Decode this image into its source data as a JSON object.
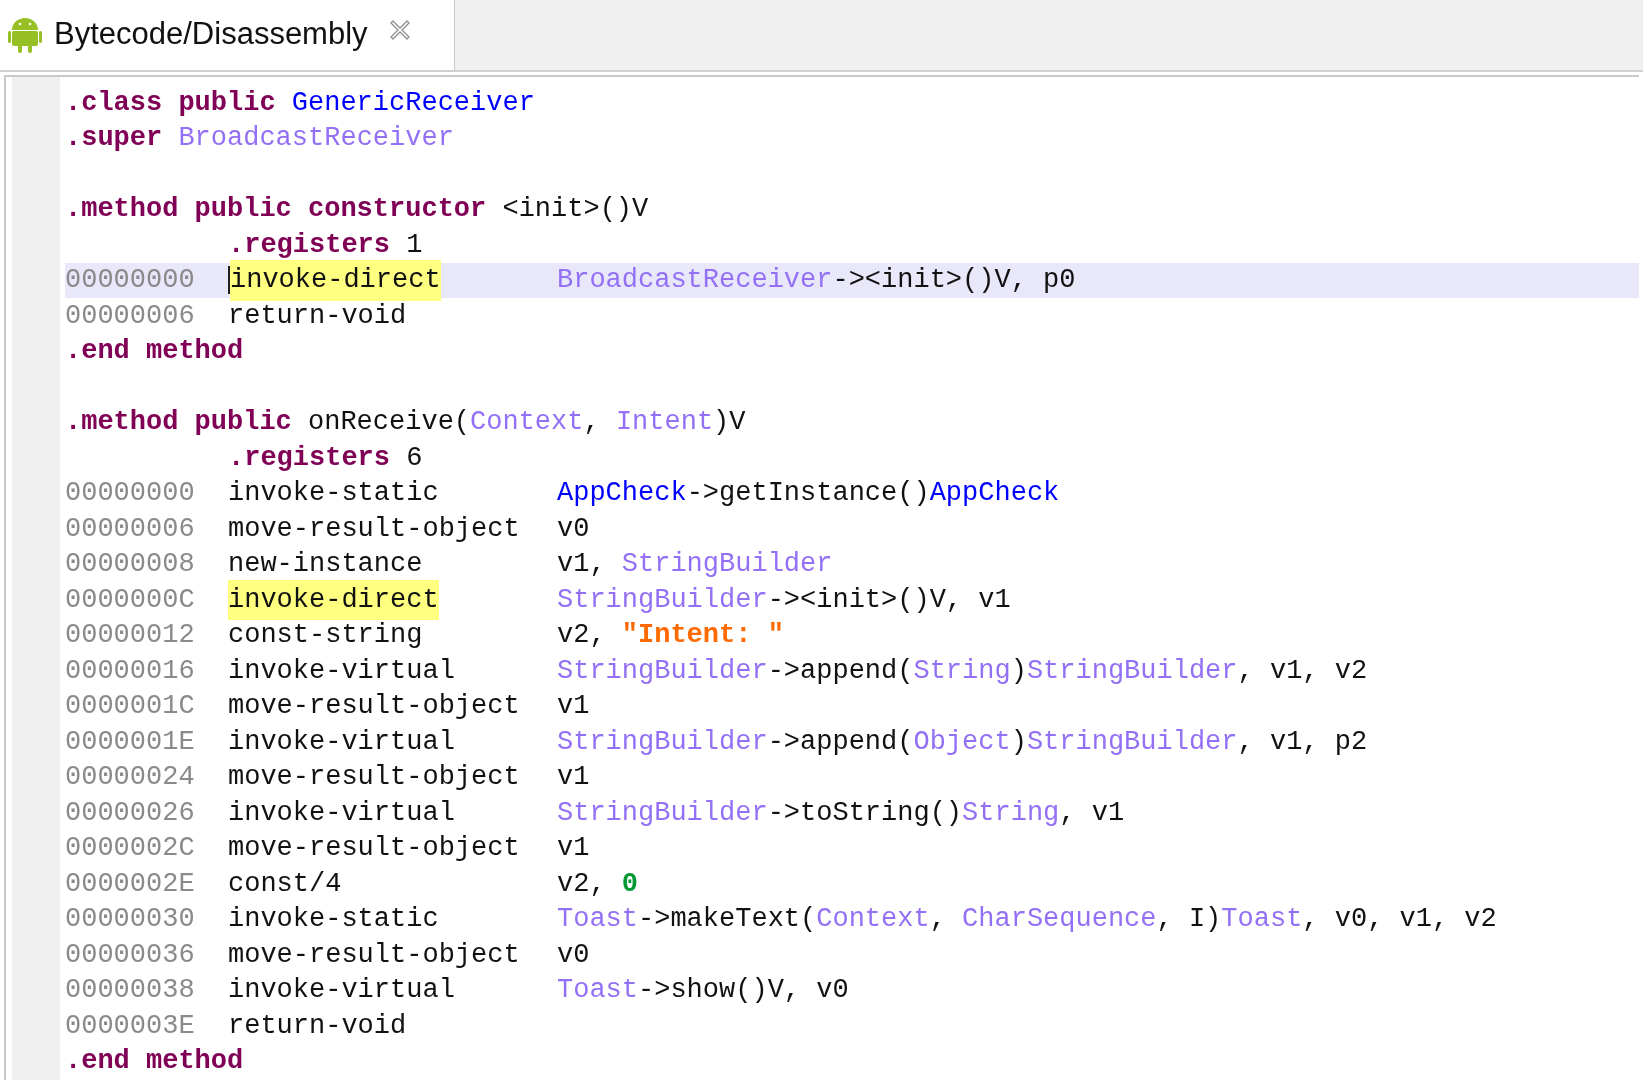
{
  "tab": {
    "title": "Bytecode/Disassembly",
    "selected": true
  },
  "lines": [
    {
      "kind": "directive",
      "tokens": [
        {
          "kind": "keyword",
          "text": ".class"
        },
        {
          "kind": "keyword",
          "text": "public"
        },
        {
          "kind": "class",
          "text": "GenericReceiver"
        }
      ]
    },
    {
      "kind": "directive",
      "tokens": [
        {
          "kind": "keyword",
          "text": ".super"
        },
        {
          "kind": "type",
          "text": "BroadcastReceiver"
        }
      ]
    },
    {
      "kind": "blank"
    },
    {
      "kind": "directive",
      "tokens": [
        {
          "kind": "keyword",
          "text": ".method"
        },
        {
          "kind": "keyword",
          "text": "public"
        },
        {
          "kind": "keyword",
          "text": "constructor"
        },
        {
          "kind": "plain",
          "text": "<init>()V"
        }
      ]
    },
    {
      "kind": "indented_directive",
      "tokens": [
        {
          "kind": "keyword",
          "text": ".registers"
        },
        {
          "kind": "plain",
          "text": "1"
        }
      ]
    },
    {
      "kind": "instruction",
      "address": "00000000",
      "opcode": "invoke-direct",
      "highlighted": true,
      "current": true,
      "operands": [
        {
          "kind": "type",
          "text": "BroadcastReceiver"
        },
        {
          "kind": "plain",
          "text": "-><init>()V, p0"
        }
      ]
    },
    {
      "kind": "instruction",
      "address": "00000006",
      "opcode": "return-void",
      "highlighted": false,
      "current": false
    },
    {
      "kind": "directive",
      "tokens": [
        {
          "kind": "keyword",
          "text": ".end"
        },
        {
          "kind": "keyword",
          "text": "method"
        }
      ]
    },
    {
      "kind": "blank"
    },
    {
      "kind": "directive",
      "tokens": [
        {
          "kind": "keyword",
          "text": ".method"
        },
        {
          "kind": "keyword",
          "text": "public"
        },
        {
          "kind": "plain",
          "text": "onReceive("
        },
        {
          "kind": "type",
          "text": "Context"
        },
        {
          "kind": "plain",
          "text": ", "
        },
        {
          "kind": "type",
          "text": "Intent"
        },
        {
          "kind": "plain",
          "text": ")V"
        }
      ]
    },
    {
      "kind": "indented_directive",
      "tokens": [
        {
          "kind": "keyword",
          "text": ".registers"
        },
        {
          "kind": "plain",
          "text": "6"
        }
      ]
    },
    {
      "kind": "instruction",
      "address": "00000000",
      "opcode": "invoke-static",
      "highlighted": false,
      "current": false,
      "operands": [
        {
          "kind": "class",
          "text": "AppCheck"
        },
        {
          "kind": "plain",
          "text": "->getInstance()"
        },
        {
          "kind": "class",
          "text": "AppCheck"
        }
      ]
    },
    {
      "kind": "instruction",
      "address": "00000006",
      "opcode": "move-result-object",
      "highlighted": false,
      "current": false,
      "operands": [
        {
          "kind": "plain",
          "text": "v0"
        }
      ]
    },
    {
      "kind": "instruction",
      "address": "00000008",
      "opcode": "new-instance",
      "highlighted": false,
      "current": false,
      "operands": [
        {
          "kind": "plain",
          "text": "v1, "
        },
        {
          "kind": "type",
          "text": "StringBuilder"
        }
      ]
    },
    {
      "kind": "instruction",
      "address": "0000000C",
      "opcode": "invoke-direct",
      "highlighted": true,
      "current": false,
      "operands": [
        {
          "kind": "type",
          "text": "StringBuilder"
        },
        {
          "kind": "plain",
          "text": "-><init>()V, v1"
        }
      ]
    },
    {
      "kind": "instruction",
      "address": "00000012",
      "opcode": "const-string",
      "highlighted": false,
      "current": false,
      "operands": [
        {
          "kind": "plain",
          "text": "v2, "
        },
        {
          "kind": "string",
          "text": "\"Intent: \""
        }
      ]
    },
    {
      "kind": "instruction",
      "address": "00000016",
      "opcode": "invoke-virtual",
      "highlighted": false,
      "current": false,
      "operands": [
        {
          "kind": "type",
          "text": "StringBuilder"
        },
        {
          "kind": "plain",
          "text": "->append("
        },
        {
          "kind": "type",
          "text": "String"
        },
        {
          "kind": "plain",
          "text": ")"
        },
        {
          "kind": "type",
          "text": "StringBuilder"
        },
        {
          "kind": "plain",
          "text": ", v1, v2"
        }
      ]
    },
    {
      "kind": "instruction",
      "address": "0000001C",
      "opcode": "move-result-object",
      "highlighted": false,
      "current": false,
      "operands": [
        {
          "kind": "plain",
          "text": "v1"
        }
      ]
    },
    {
      "kind": "instruction",
      "address": "0000001E",
      "opcode": "invoke-virtual",
      "highlighted": false,
      "current": false,
      "operands": [
        {
          "kind": "type",
          "text": "StringBuilder"
        },
        {
          "kind": "plain",
          "text": "->append("
        },
        {
          "kind": "type",
          "text": "Object"
        },
        {
          "kind": "plain",
          "text": ")"
        },
        {
          "kind": "type",
          "text": "StringBuilder"
        },
        {
          "kind": "plain",
          "text": ", v1, p2"
        }
      ]
    },
    {
      "kind": "instruction",
      "address": "00000024",
      "opcode": "move-result-object",
      "highlighted": false,
      "current": false,
      "operands": [
        {
          "kind": "plain",
          "text": "v1"
        }
      ]
    },
    {
      "kind": "instruction",
      "address": "00000026",
      "opcode": "invoke-virtual",
      "highlighted": false,
      "current": false,
      "operands": [
        {
          "kind": "type",
          "text": "StringBuilder"
        },
        {
          "kind": "plain",
          "text": "->toString()"
        },
        {
          "kind": "type",
          "text": "String"
        },
        {
          "kind": "plain",
          "text": ", v1"
        }
      ]
    },
    {
      "kind": "instruction",
      "address": "0000002C",
      "opcode": "move-result-object",
      "highlighted": false,
      "current": false,
      "operands": [
        {
          "kind": "plain",
          "text": "v1"
        }
      ]
    },
    {
      "kind": "instruction",
      "address": "0000002E",
      "opcode": "const/4",
      "highlighted": false,
      "current": false,
      "operands": [
        {
          "kind": "plain",
          "text": "v2, "
        },
        {
          "kind": "number",
          "text": "0"
        }
      ]
    },
    {
      "kind": "instruction",
      "address": "00000030",
      "opcode": "invoke-static",
      "highlighted": false,
      "current": false,
      "operands": [
        {
          "kind": "type",
          "text": "Toast"
        },
        {
          "kind": "plain",
          "text": "->makeText("
        },
        {
          "kind": "type",
          "text": "Context"
        },
        {
          "kind": "plain",
          "text": ", "
        },
        {
          "kind": "type",
          "text": "CharSequence"
        },
        {
          "kind": "plain",
          "text": ", I)"
        },
        {
          "kind": "type",
          "text": "Toast"
        },
        {
          "kind": "plain",
          "text": ", v0, v1, v2"
        }
      ]
    },
    {
      "kind": "instruction",
      "address": "00000036",
      "opcode": "move-result-object",
      "highlighted": false,
      "current": false,
      "operands": [
        {
          "kind": "plain",
          "text": "v0"
        }
      ]
    },
    {
      "kind": "instruction",
      "address": "00000038",
      "opcode": "invoke-virtual",
      "highlighted": false,
      "current": false,
      "operands": [
        {
          "kind": "type",
          "text": "Toast"
        },
        {
          "kind": "plain",
          "text": "->show()V, v0"
        }
      ]
    },
    {
      "kind": "instruction",
      "address": "0000003E",
      "opcode": "return-void",
      "highlighted": false,
      "current": false
    },
    {
      "kind": "directive",
      "tokens": [
        {
          "kind": "keyword",
          "text": ".end"
        },
        {
          "kind": "keyword",
          "text": "method"
        }
      ]
    }
  ]
}
